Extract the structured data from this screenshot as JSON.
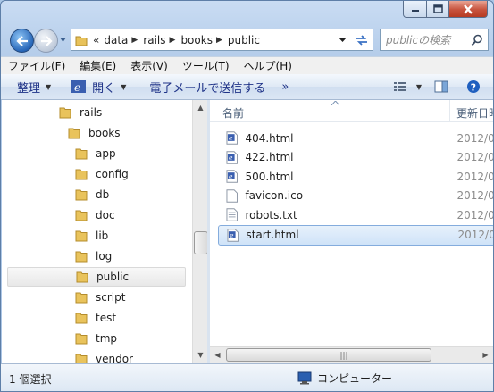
{
  "window": {
    "caption_buttons": [
      "minimize",
      "maximize",
      "close"
    ]
  },
  "address_bar": {
    "overflow_glyph": "«",
    "crumbs": [
      "data",
      "rails",
      "books",
      "public"
    ]
  },
  "search": {
    "placeholder": "publicの検索"
  },
  "menu": [
    "ファイル(F)",
    "編集(E)",
    "表示(V)",
    "ツール(T)",
    "ヘルプ(H)"
  ],
  "toolbar": {
    "organize": "整理",
    "open": "開く",
    "email": "電子メールで送信する",
    "more": "»"
  },
  "tree": {
    "items": [
      "rails",
      "books",
      "app",
      "config",
      "db",
      "doc",
      "lib",
      "log",
      "public",
      "script",
      "test",
      "tmp",
      "vendor"
    ],
    "selected": "public"
  },
  "columns": {
    "name": "名前",
    "date": "更新日時"
  },
  "files": [
    {
      "name": "404.html",
      "date": "2012/0",
      "type": "html"
    },
    {
      "name": "422.html",
      "date": "2012/0",
      "type": "html"
    },
    {
      "name": "500.html",
      "date": "2012/0",
      "type": "html"
    },
    {
      "name": "favicon.ico",
      "date": "2012/0",
      "type": "blank"
    },
    {
      "name": "robots.txt",
      "date": "2012/0",
      "type": "text"
    },
    {
      "name": "start.html",
      "date": "2012/0",
      "type": "html",
      "selected": true
    }
  ],
  "status": {
    "selection": "1 個選択",
    "location": "コンピューター"
  },
  "colors": {
    "frame": "#b5cdea",
    "selection_fill": "#cfe3f8",
    "selection_border": "#84acdd",
    "toolbar_text": "#1e3287"
  }
}
